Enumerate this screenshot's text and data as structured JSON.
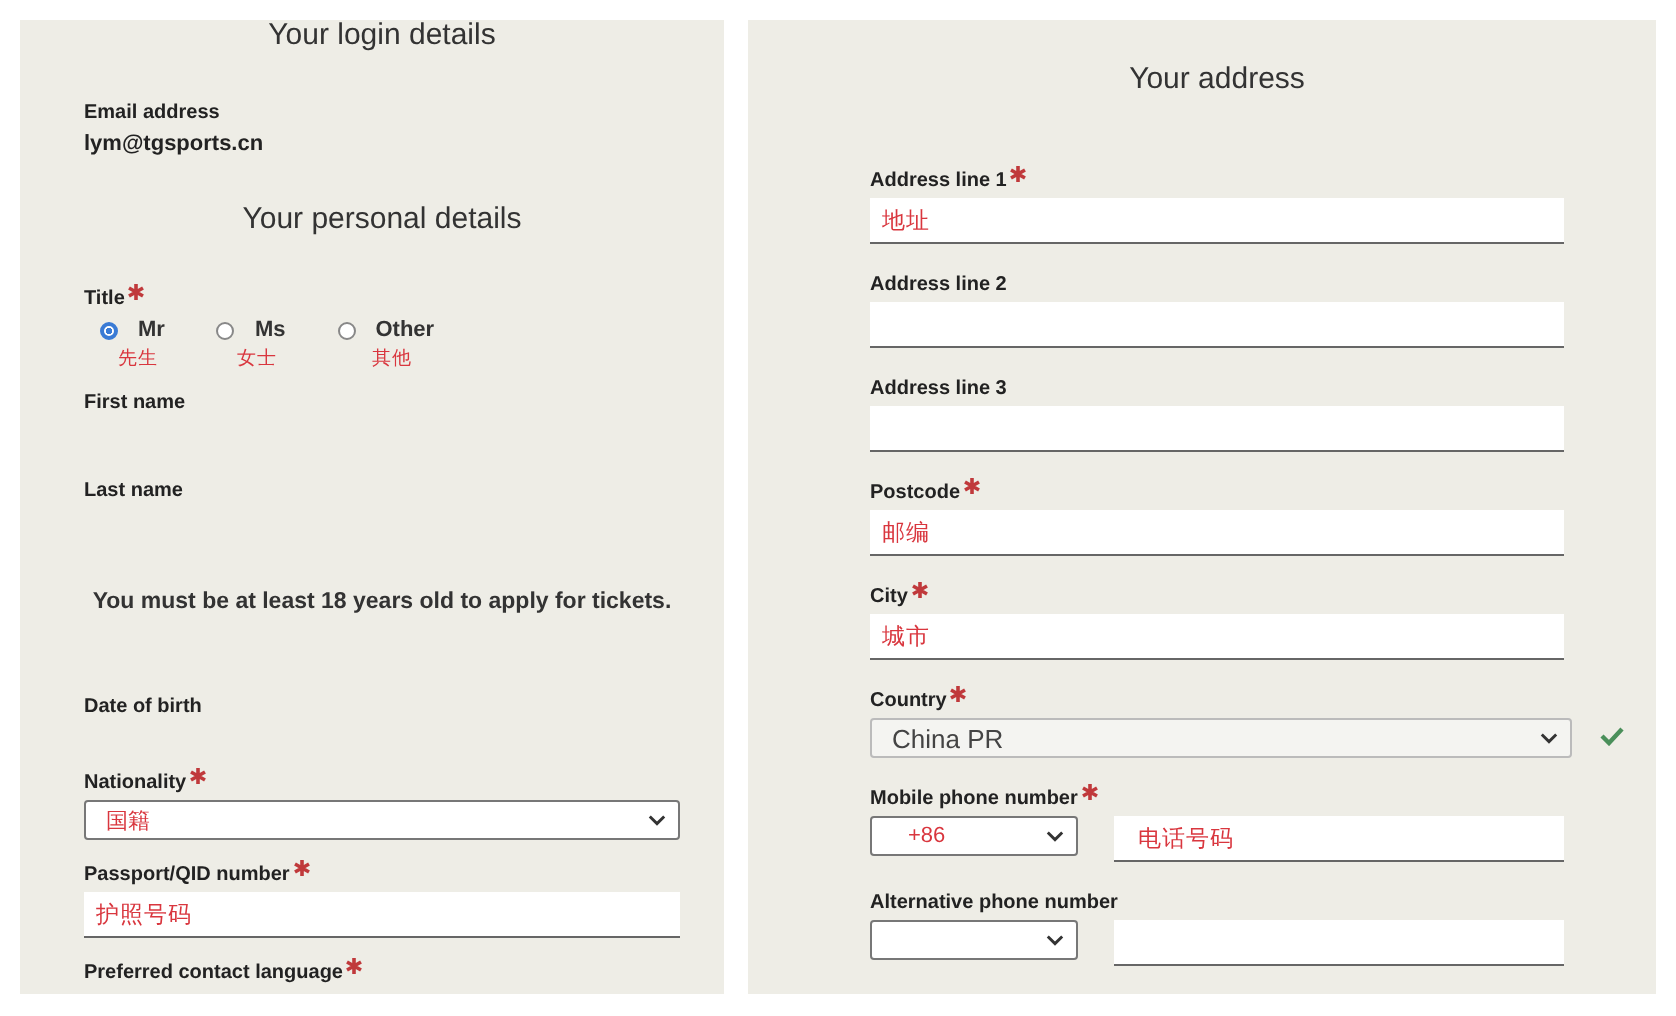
{
  "login_details": {
    "heading": "Your login details",
    "fields": [
      {
        "label": "Email address",
        "value": "lym@tgsports.cn"
      }
    ]
  },
  "personal_details": {
    "heading": "Your personal details",
    "items": [
      {
        "kind": "radio_group",
        "label": "Title",
        "required": true,
        "options": [
          {
            "label": "Mr",
            "note": "先生",
            "selected": true
          },
          {
            "label": "Ms",
            "note": "女士",
            "selected": false
          },
          {
            "label": "Other",
            "note": "其他",
            "selected": false
          }
        ]
      },
      {
        "kind": "text",
        "label": "First name",
        "required": false
      },
      {
        "kind": "text",
        "label": "Last name",
        "required": false
      },
      {
        "kind": "notice",
        "text": "You must be at least 18 years old to apply for tickets."
      },
      {
        "kind": "text",
        "label": "Date of birth",
        "required": false
      },
      {
        "kind": "select",
        "label": "Nationality",
        "required": true,
        "value": "国籍",
        "annotated": true
      },
      {
        "kind": "input",
        "label": "Passport/QID number",
        "required": true,
        "value": "护照号码",
        "annotated": true
      },
      {
        "kind": "label",
        "label": "Preferred contact language",
        "required": true
      }
    ]
  },
  "address": {
    "heading": "Your address",
    "fields": [
      {
        "kind": "input",
        "label": "Address line 1",
        "required": true,
        "value": "地址",
        "annotated": true
      },
      {
        "kind": "input",
        "label": "Address line 2",
        "required": false
      },
      {
        "kind": "input",
        "label": "Address line 3",
        "required": false
      },
      {
        "kind": "input",
        "label": "Postcode",
        "required": true,
        "value": "邮编",
        "annotated": true
      },
      {
        "kind": "input",
        "label": "City",
        "required": true,
        "value": "城市",
        "annotated": true
      },
      {
        "kind": "select",
        "label": "Country",
        "required": true,
        "value": "China PR",
        "annotated": false,
        "valid": true
      },
      {
        "kind": "phone",
        "label": "Mobile phone number",
        "required": true,
        "code": "+86",
        "value": "电话号码",
        "annotated": true
      },
      {
        "kind": "phone",
        "label": "Alternative phone number",
        "required": false
      }
    ]
  }
}
